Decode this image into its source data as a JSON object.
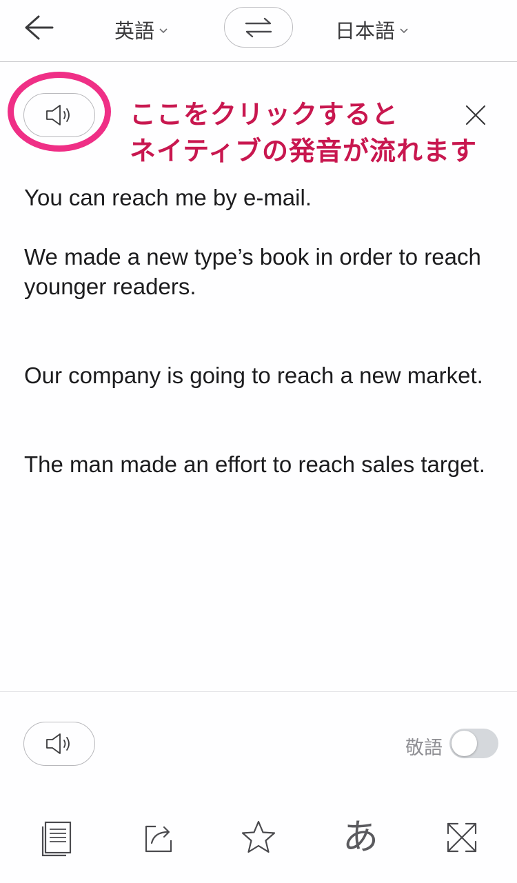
{
  "header": {
    "source_language": "英語",
    "target_language": "日本語"
  },
  "annotation": {
    "line1": "ここをクリックすると",
    "line2": "ネイティブの発音が流れます",
    "color": "#c8174f",
    "circle_color": "#ef2f86"
  },
  "sentences": [
    "You can reach me by e-mail.",
    "We made a new type’s book in order to reach younger readers.",
    "Our company is going to reach a new market.",
    "The man made an effort to reach sales target."
  ],
  "footer": {
    "keigo_label": "敬語",
    "keigo_enabled": false
  },
  "toolbar": {
    "hiragana_glyph": "あ",
    "icons": [
      "copy-icon",
      "share-icon",
      "star-icon",
      "hiragana-icon",
      "expand-icon"
    ]
  },
  "icons": {
    "back": "arrow-left-icon",
    "swap": "swap-arrows-icon",
    "speaker": "speaker-icon",
    "close": "close-icon"
  }
}
